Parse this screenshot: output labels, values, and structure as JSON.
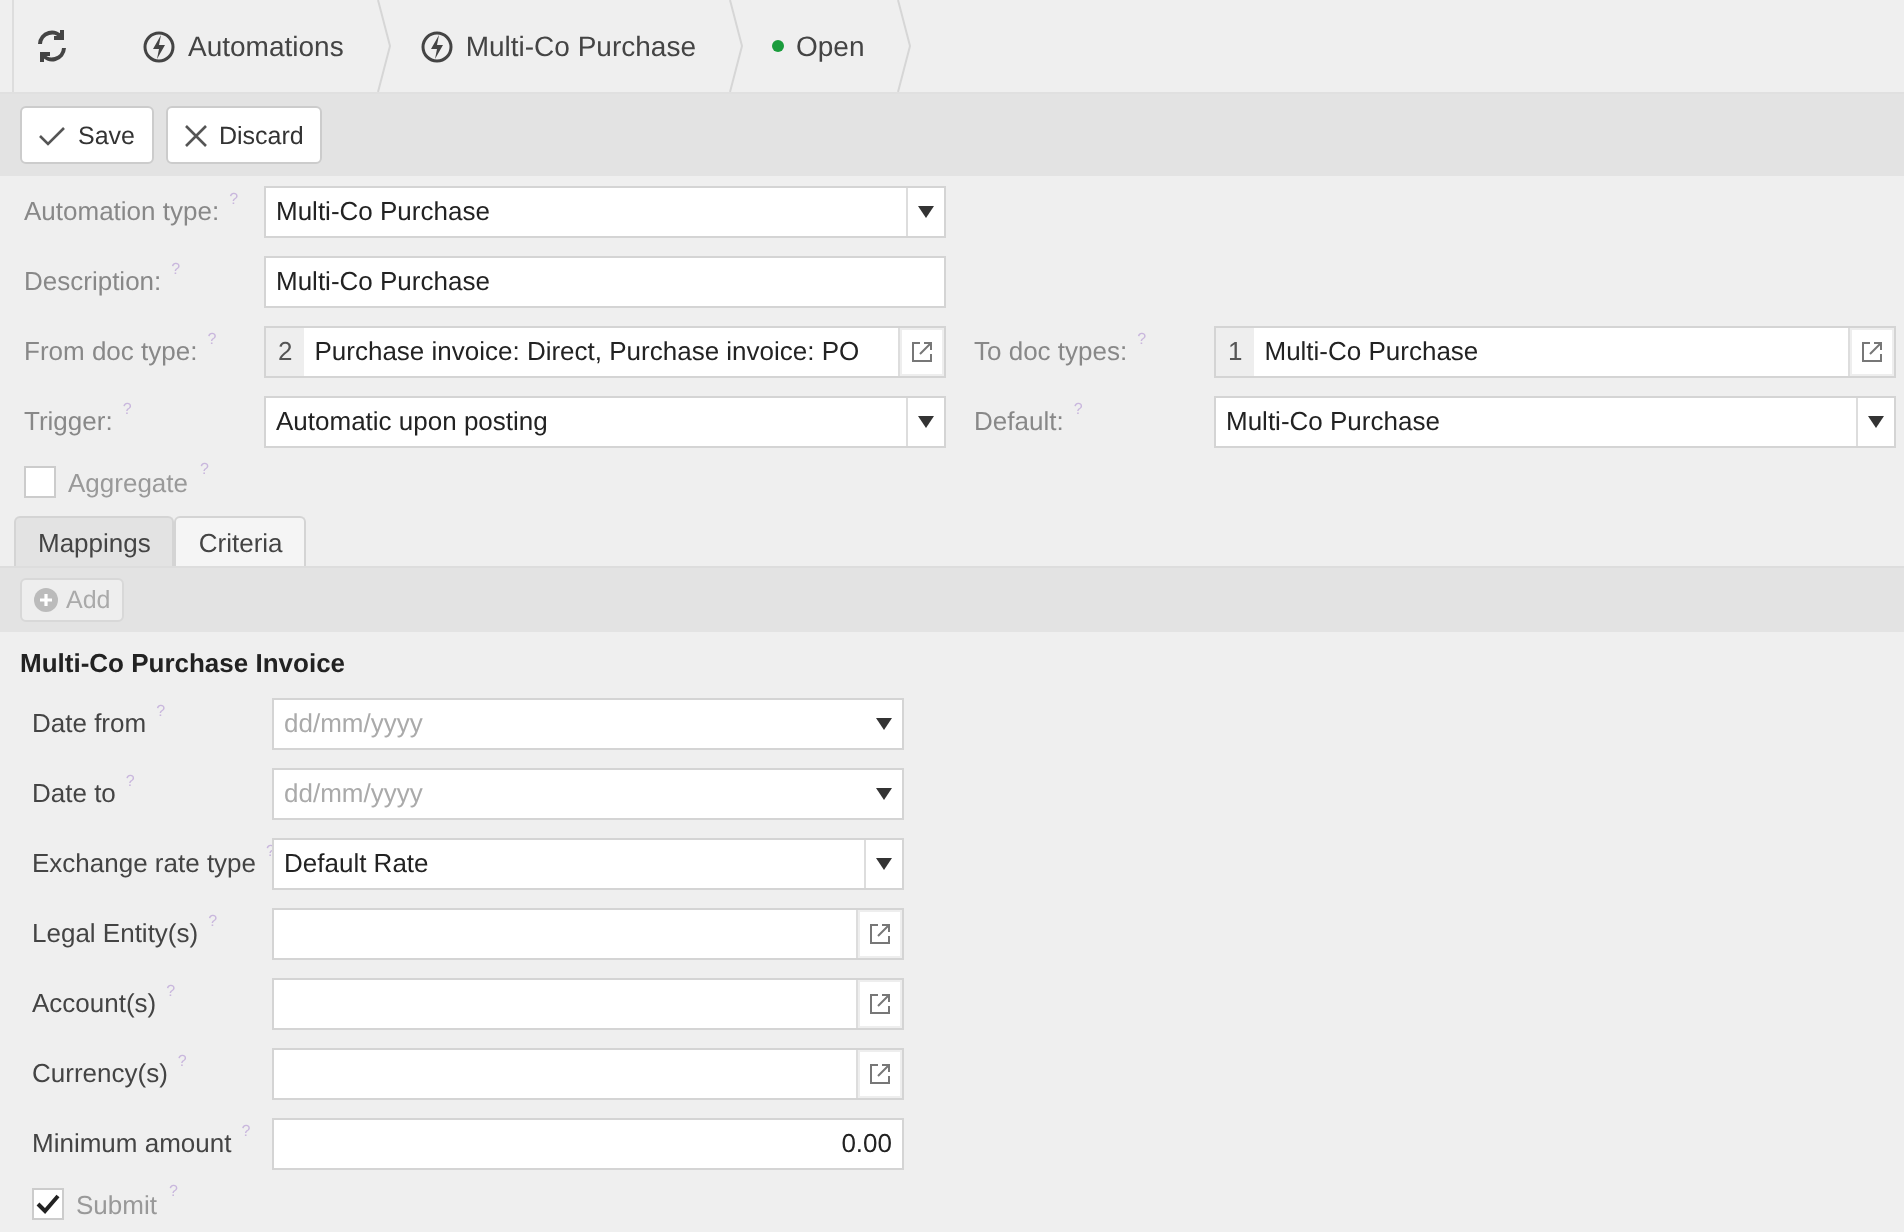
{
  "breadcrumbs": [
    {
      "kind": "refresh"
    },
    {
      "kind": "link",
      "label": "Automations"
    },
    {
      "kind": "link",
      "label": "Multi-Co Purchase"
    },
    {
      "kind": "status",
      "label": "Open",
      "color": "#1a9c3c"
    }
  ],
  "toolbar": [
    {
      "kind": "save",
      "label": "Save"
    },
    {
      "kind": "discard",
      "label": "Discard"
    }
  ],
  "header": {
    "rows": [
      {
        "fields": [
          {
            "kind": "select",
            "label": "Automation type:",
            "help": "?",
            "value": "Multi-Co Purchase"
          }
        ]
      },
      {
        "fields": [
          {
            "kind": "text",
            "label": "Description:",
            "help": "?",
            "value": "Multi-Co Purchase"
          }
        ]
      },
      {
        "fields": [
          {
            "kind": "multi",
            "label": "From doc type:",
            "help": "?",
            "count": "2",
            "value": "Purchase invoice: Direct, Purchase invoice: PO"
          },
          {
            "kind": "multi",
            "label": "To doc types:",
            "help": "?",
            "count": "1",
            "value": "Multi-Co Purchase"
          }
        ]
      },
      {
        "fields": [
          {
            "kind": "select",
            "label": "Trigger:",
            "help": "?",
            "value": "Automatic upon posting"
          },
          {
            "kind": "select",
            "label": "Default:",
            "help": "?",
            "value": "Multi-Co Purchase"
          }
        ]
      },
      {
        "fields": [
          {
            "kind": "checkbox",
            "label": "Aggregate",
            "help": "?",
            "checked": false
          }
        ]
      }
    ]
  },
  "tabs": [
    {
      "label": "Mappings",
      "selected": false
    },
    {
      "label": "Criteria",
      "selected": true
    }
  ],
  "add_button": {
    "label": "Add",
    "disabled": true
  },
  "criteria": {
    "title": "Multi-Co Purchase Invoice",
    "fields": [
      {
        "kind": "date",
        "label": "Date from",
        "help": "?",
        "placeholder": "dd/mm/yyyy"
      },
      {
        "kind": "date",
        "label": "Date to",
        "help": "?",
        "placeholder": "dd/mm/yyyy"
      },
      {
        "kind": "select",
        "label": "Exchange rate type",
        "help": "?",
        "value": "Default Rate"
      },
      {
        "kind": "lookup",
        "label": "Legal Entity(s)",
        "help": "?"
      },
      {
        "kind": "lookup",
        "label": "Account(s)",
        "help": "?"
      },
      {
        "kind": "lookup",
        "label": "Currency(s)",
        "help": "?"
      },
      {
        "kind": "number",
        "label": "Minimum amount",
        "help": "?",
        "value": "0.00"
      },
      {
        "kind": "checkbox",
        "label": "Submit",
        "help": "?",
        "checked": true
      }
    ]
  }
}
